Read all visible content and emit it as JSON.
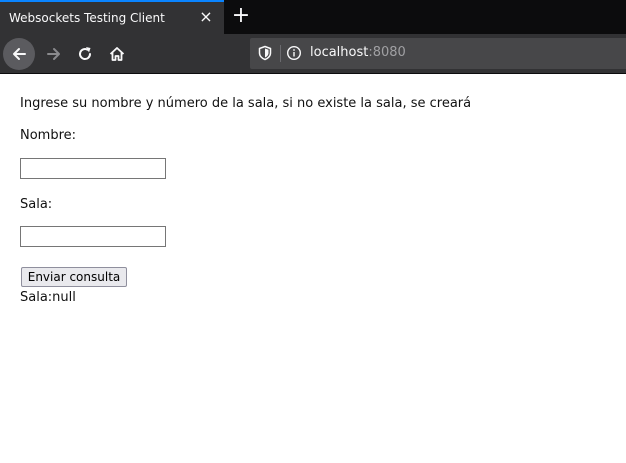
{
  "browser": {
    "tab": {
      "title": "Websockets Testing Client",
      "close_icon": "×"
    },
    "new_tab_icon": "+",
    "url": {
      "host": "localhost",
      "port": ":8080"
    }
  },
  "page": {
    "instructions": "Ingrese su nombre y número de la sala, si no existe la sala, se creará",
    "nombre_label": "Nombre:",
    "nombre_value": "",
    "sala_label": "Sala:",
    "sala_value": "",
    "submit_label": "Enviar consulta",
    "status": "Sala:null"
  },
  "colors": {
    "accent": "#0a84ff",
    "toolbar": "#323234",
    "tabstrip": "#0c0c0d"
  }
}
